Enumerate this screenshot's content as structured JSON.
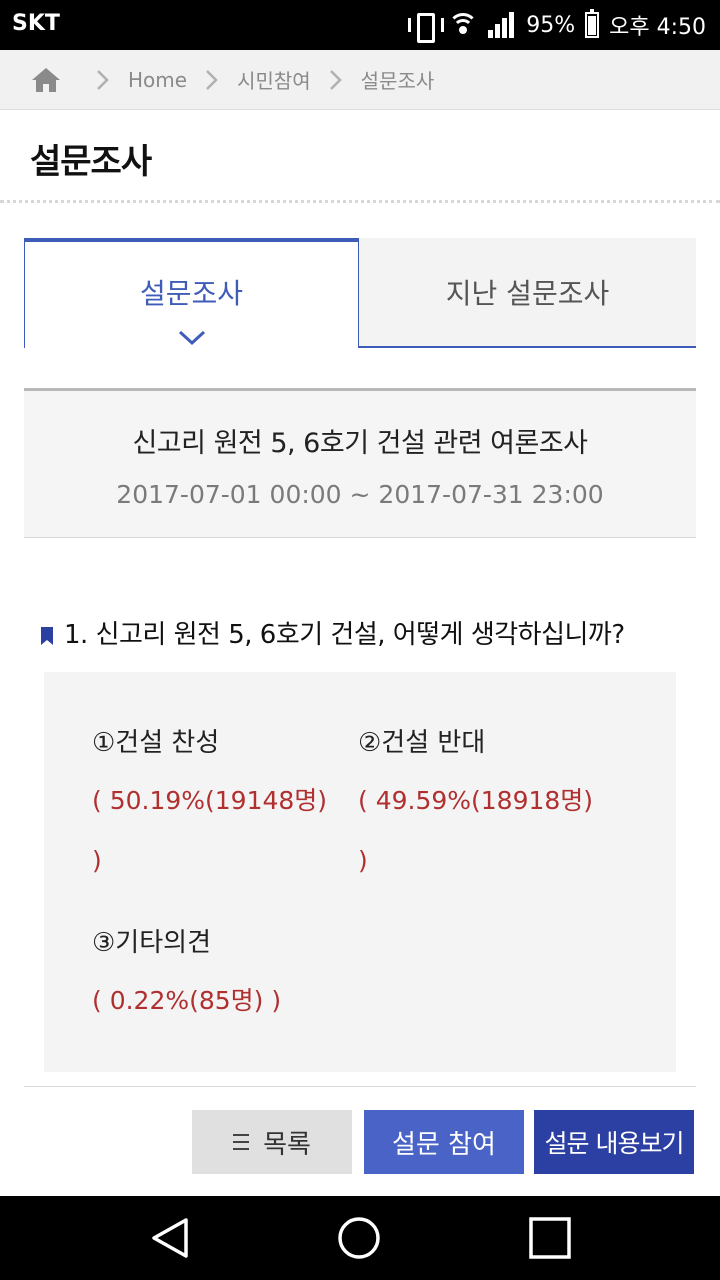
{
  "status_bar": {
    "carrier": "SKT",
    "battery": "95%",
    "time": "오후 4:50"
  },
  "breadcrumb": {
    "items": [
      "Home",
      "시민참여",
      "설문조사"
    ]
  },
  "page": {
    "title": "설문조사"
  },
  "tabs": [
    {
      "label": "설문조사",
      "active": true
    },
    {
      "label": "지난 설문조사",
      "active": false
    }
  ],
  "survey": {
    "title": "신고리 원전 5, 6호기 건설 관련 여론조사",
    "period": "2017-07-01 00:00 ~ 2017-07-31 23:00"
  },
  "question": {
    "text": "1. 신고리 원전 5, 6호기 건설, 어떻게 생각하십니까?",
    "options": [
      {
        "label": "①건설 찬성",
        "result_line1": "( 50.19%(19148명)",
        "result_line2": ")"
      },
      {
        "label": "②건설 반대",
        "result_line1": "( 49.59%(18918명)",
        "result_line2": ")"
      },
      {
        "label": "③기타의견",
        "result_line1": "( 0.22%(85명) )",
        "result_line2": ""
      }
    ]
  },
  "buttons": {
    "list": "목록",
    "join": "설문 참여",
    "view": "설문 내용보기"
  },
  "colors": {
    "accent": "#3f5cb8",
    "result_text": "#b03030",
    "join_button": "#4a63c6",
    "view_button": "#2c40a3"
  }
}
